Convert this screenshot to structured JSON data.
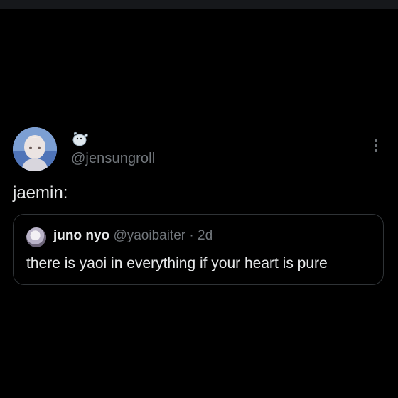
{
  "tweet": {
    "author": {
      "display_name_icon": "seal-emoji-icon",
      "handle": "@jensungroll"
    },
    "text": "jaemin:",
    "more_icon": "more-vertical-icon"
  },
  "quoted_tweet": {
    "display_name": "juno nyo",
    "handle": "@yaoibaiter",
    "separator": "·",
    "time": "2d",
    "text": "there is yaoi in everything if your heart is pure"
  },
  "colors": {
    "background": "#000000",
    "text_primary": "#e7e9ea",
    "text_secondary": "#71767b",
    "border": "#2f3336"
  }
}
